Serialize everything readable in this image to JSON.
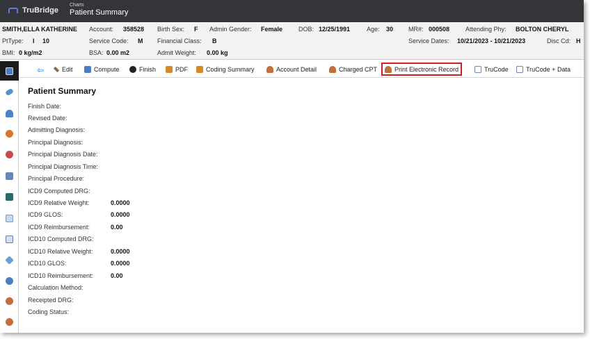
{
  "app": {
    "brand": "TruBridge",
    "breadcrumb": "Charts",
    "title": "Patient Summary"
  },
  "patient": {
    "name": "SMITH,ELLA KATHERINE",
    "fields": [
      {
        "label": "Account:",
        "value": "358528"
      },
      {
        "label": "Birth Sex:",
        "value": "F"
      },
      {
        "label": "Admin Gender:",
        "value": "Female"
      },
      {
        "label": "DOB:",
        "value": "12/25/1991"
      },
      {
        "label": "Age:",
        "value": "30"
      },
      {
        "label": "MR#:",
        "value": "000508"
      },
      {
        "label": "Attending Phy:",
        "value": "BOLTON CHERYL"
      },
      {
        "label": "PtType:",
        "value": "I"
      },
      {
        "label": "",
        "value": "10"
      },
      {
        "label": "Service Code:",
        "value": "M"
      },
      {
        "label": "Financial Class:",
        "value": "B"
      },
      {
        "label": "Service Dates:",
        "value": "10/21/2023 - 10/21/2023"
      },
      {
        "label": "Disc Cd:",
        "value": "H"
      },
      {
        "label": "BMI:",
        "value": "0 kg/m2"
      },
      {
        "label": "BSA:",
        "value": "0.00 m2"
      },
      {
        "label": "Admit Weight:",
        "value": "0.00 kg"
      }
    ]
  },
  "sidebar": {
    "items": [
      {
        "icon": "patient-summary-icon",
        "active": true,
        "color": "#4a7ec4"
      },
      {
        "icon": "pill-icon",
        "color": "#5a8fcf"
      },
      {
        "icon": "person-icon",
        "color": "#4a86c5"
      },
      {
        "icon": "vitals-icon",
        "color": "#d9742a"
      },
      {
        "icon": "nurse-icon",
        "color": "#c64a4a"
      },
      {
        "icon": "calculator-icon",
        "color": "#6a86b8"
      },
      {
        "icon": "book-icon",
        "color": "#2a6a6a"
      },
      {
        "icon": "document-icon",
        "color": "#7a9ac8"
      },
      {
        "icon": "report-icon",
        "color": "#5a7cb8"
      },
      {
        "icon": "tag-icon",
        "color": "#6aa0d8"
      },
      {
        "icon": "globe-icon",
        "color": "#4a80c0"
      },
      {
        "icon": "group-icon",
        "color": "#c86a3a"
      },
      {
        "icon": "group-alt-icon",
        "color": "#c86a3a"
      }
    ]
  },
  "toolbar": {
    "buttons": [
      {
        "label": "Edit",
        "icon": "edit-icon",
        "color": "#8a6a4a"
      },
      {
        "label": "Compute",
        "icon": "calculator-icon",
        "color": "#4a7ec4"
      },
      {
        "label": "Finish",
        "icon": "check-icon",
        "color": "#222222"
      },
      {
        "label": "PDF",
        "icon": "pdf-icon",
        "color": "#d48a2a"
      },
      {
        "label": "Coding Summary",
        "icon": "pdf-icon",
        "color": "#d48a2a"
      },
      {
        "label": "Account Detail",
        "icon": "user-icon",
        "color": "#c0703a"
      },
      {
        "label": "Charged CPT",
        "icon": "user-icon",
        "color": "#c0703a"
      },
      {
        "label": "Print Electronic Record",
        "icon": "user-icon",
        "color": "#c0703a"
      },
      {
        "label": "TruCode",
        "icon": "trucode-icon",
        "color": "#6a86b8"
      },
      {
        "label": "TruCode + Data",
        "icon": "trucode-icon",
        "color": "#6a86b8"
      }
    ]
  },
  "summary": {
    "title": "Patient Summary",
    "rows": [
      {
        "label": "Finish Date:",
        "value": ""
      },
      {
        "label": "Revised Date:",
        "value": ""
      },
      {
        "label": "Admitting Diagnosis:",
        "value": ""
      },
      {
        "label": "Principal Diagnosis:",
        "value": ""
      },
      {
        "label": "Principal Diagnosis Date:",
        "value": ""
      },
      {
        "label": "Principal Diagnosis Time:",
        "value": ""
      },
      {
        "label": "Principal Procedure:",
        "value": ""
      },
      {
        "label": "ICD9 Computed DRG:",
        "value": ""
      },
      {
        "label": "ICD9 Relative Weight:",
        "value": "0.0000"
      },
      {
        "label": "ICD9 GLOS:",
        "value": "0.0000"
      },
      {
        "label": "ICD9 Reimbursement:",
        "value": "0.00"
      },
      {
        "label": "ICD10 Computed DRG:",
        "value": ""
      },
      {
        "label": "ICD10 Relative Weight:",
        "value": "0.0000"
      },
      {
        "label": "ICD10 GLOS:",
        "value": "0.0000"
      },
      {
        "label": "ICD10 Reimbursement:",
        "value": "0.00"
      },
      {
        "label": "Calculation Method:",
        "value": ""
      },
      {
        "label": "Receipted DRG:",
        "value": ""
      },
      {
        "label": "Coding Status:",
        "value": ""
      }
    ]
  }
}
